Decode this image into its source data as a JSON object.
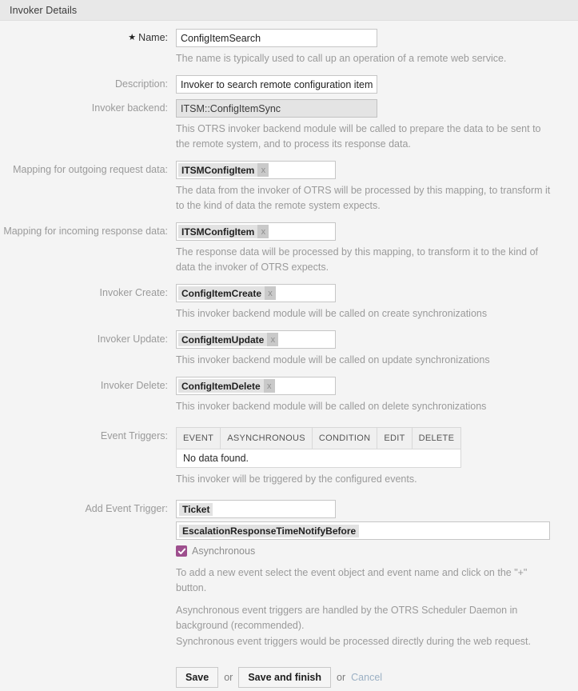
{
  "header": {
    "title": "Invoker Details"
  },
  "colors": {
    "header_bg": "#e8e8e8",
    "page_bg": "#f4f4f4",
    "checkbox_accent": "#9e4f8e",
    "cancel_link": "#9bb0c4",
    "label_gray": "#9a9a9a"
  },
  "fields": {
    "name": {
      "label": "Name:",
      "required_marker": "★",
      "value": "ConfigItemSearch",
      "help": "The name is typically used to call up an operation of a remote web service."
    },
    "description": {
      "label": "Description:",
      "value": "Invoker to search remote configuration items"
    },
    "invoker_backend": {
      "label": "Invoker backend:",
      "value": "ITSM::ConfigItemSync",
      "help": "This OTRS invoker backend module will be called to prepare the data to be sent to the remote system, and to process its response data."
    },
    "mapping_outgoing": {
      "label": "Mapping for outgoing request data:",
      "token": "ITSMConfigItem",
      "token_remove": "x",
      "help": "The data from the invoker of OTRS will be processed by this mapping, to transform it to the kind of data the remote system expects."
    },
    "mapping_incoming": {
      "label": "Mapping for incoming response data:",
      "token": "ITSMConfigItem",
      "token_remove": "x",
      "help": "The response data will be processed by this mapping, to transform it to the kind of data the invoker of OTRS expects."
    },
    "invoker_create": {
      "label": "Invoker Create:",
      "token": "ConfigItemCreate",
      "token_remove": "x",
      "help": "This invoker backend module will be called on create synchronizations"
    },
    "invoker_update": {
      "label": "Invoker Update:",
      "token": "ConfigItemUpdate",
      "token_remove": "x",
      "help": "This invoker backend module will be called on update synchronizations"
    },
    "invoker_delete": {
      "label": "Invoker Delete:",
      "token": "ConfigItemDelete",
      "token_remove": "x",
      "help": "This invoker backend module will be called on delete synchronizations"
    },
    "event_triggers": {
      "label": "Event Triggers:",
      "help": "This invoker will be triggered by the configured events."
    },
    "add_event_trigger": {
      "label": "Add Event Trigger:",
      "object_value": "Ticket",
      "event_value": "EscalationResponseTimeNotifyBefore",
      "asynchronous_label": "Asynchronous",
      "asynchronous_checked": true,
      "help_1": "To add a new event select the event object and event name and click on the \"+\" button.",
      "help_2": "Asynchronous event triggers are handled by the OTRS Scheduler Daemon in background (recommended).",
      "help_3": "Synchronous event triggers would be processed directly during the web request."
    }
  },
  "triggers_table": {
    "columns": [
      "EVENT",
      "ASYNCHRONOUS",
      "CONDITION",
      "EDIT",
      "DELETE"
    ],
    "empty_message": "No data found.",
    "rows": []
  },
  "actions": {
    "save_label": "Save",
    "or_1": "or",
    "save_and_finish_label": "Save and finish",
    "or_2": "or",
    "cancel_label": "Cancel"
  }
}
